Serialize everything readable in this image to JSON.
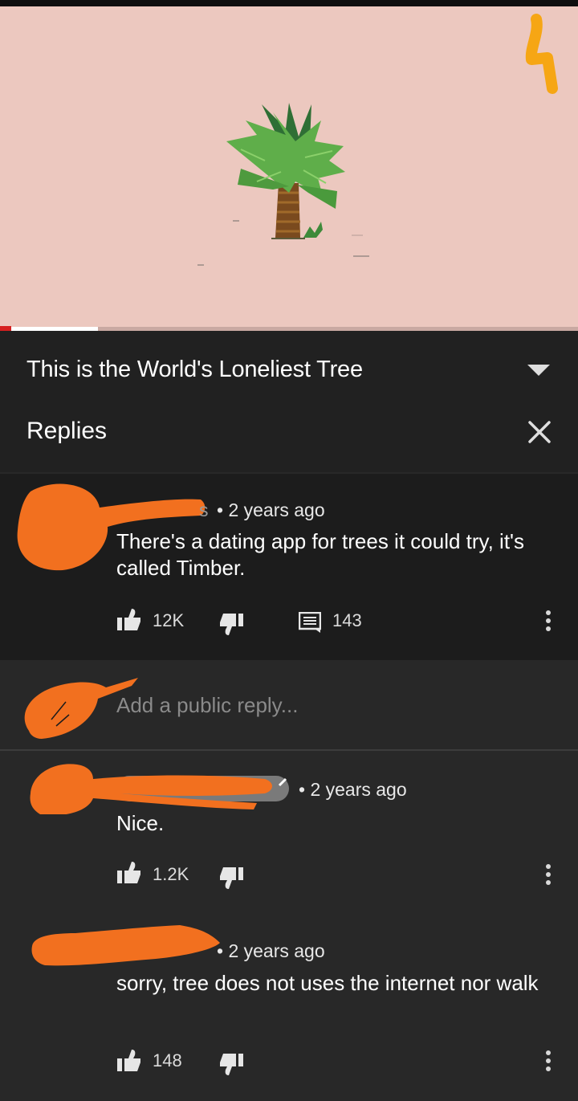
{
  "video": {
    "title": "This is the World's Loneliest Tree",
    "progress": 0.17,
    "colors": {
      "background": "#ecc8bf",
      "progress": "#ffffff",
      "accent": "#d62020"
    }
  },
  "panel": {
    "heading": "Replies",
    "expand_icon": "chevron-down-icon",
    "close_icon": "close-icon"
  },
  "parent_comment": {
    "author_fragment": "s",
    "meta": "• 2 years ago",
    "text": "There's a dating app for trees it could try, it's called Timber.",
    "likes": "12K",
    "replies": "143"
  },
  "reply_box": {
    "placeholder": "Add a public reply..."
  },
  "replies": [
    {
      "meta": "• 2 years ago",
      "text": "Nice.",
      "likes": "1.2K"
    },
    {
      "meta": "• 2 years ago",
      "text": "sorry, tree does not uses the internet nor walk",
      "likes": "148"
    }
  ]
}
